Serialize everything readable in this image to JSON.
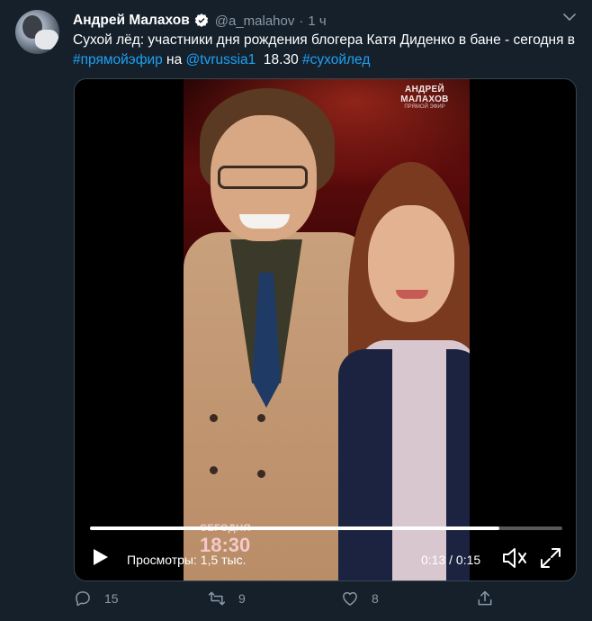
{
  "tweet": {
    "author_name": "Андрей Малахов",
    "handle": "@a_malahov",
    "separator": "·",
    "time": "1 ч",
    "text_parts": [
      {
        "text": "Сухой лёд: участники дня рождения блогера Катя Диденко в бане - сегодня в ",
        "link": false
      },
      {
        "text": "#прямойэфир",
        "link": true
      },
      {
        "text": " на ",
        "link": false
      },
      {
        "text": "@tvrussia1",
        "link": true
      },
      {
        "text": "  18.30 ",
        "link": false
      },
      {
        "text": "#сухойлед",
        "link": true
      }
    ]
  },
  "video": {
    "overlay_logo_line1": "АНДРЕЙ МАЛАХОВ",
    "overlay_logo_line2": "ПРЯМОЙ ЭФИР",
    "overlay_today": "СЕГОДНЯ",
    "overlay_time": "18:30",
    "views_label": "Просмотры: 1,5 тыс.",
    "timecode": "0:13 / 0:15",
    "progress": 0.867
  },
  "actions": {
    "reply_count": "15",
    "retweet_count": "9",
    "like_count": "8"
  },
  "colors": {
    "background": "#15202b",
    "text_secondary": "#8899a6",
    "link": "#1da1f2",
    "verified": "#ffffff"
  },
  "icons": [
    "verified-badge-icon",
    "chevron-down-icon",
    "play-icon",
    "volume-icon",
    "fullscreen-icon",
    "reply-icon",
    "retweet-icon",
    "like-icon",
    "share-icon"
  ]
}
